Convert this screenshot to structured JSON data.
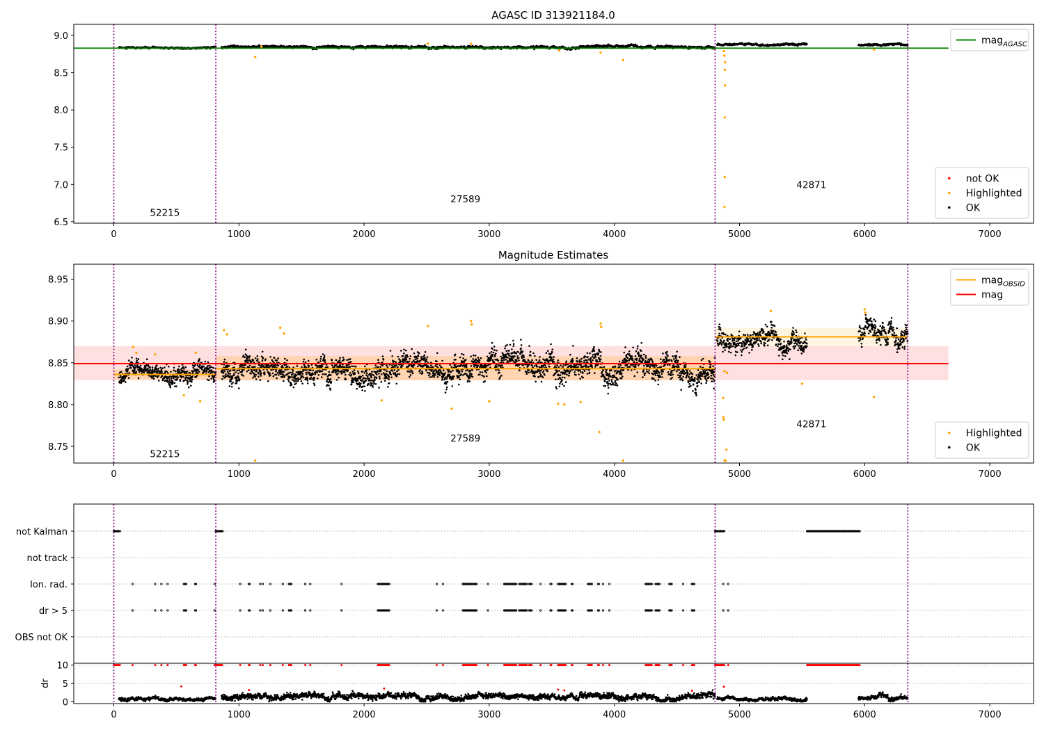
{
  "figure": {
    "background": "#ffffff"
  },
  "chart_data": [
    {
      "id": "top",
      "type": "scatter",
      "title": "AGASC ID 313921184.0",
      "xlim": [
        -320,
        7350
      ],
      "ylim": [
        6.48,
        9.15
      ],
      "xticks": [
        0,
        1000,
        2000,
        3000,
        4000,
        5000,
        6000,
        7000
      ],
      "xtick_labels": [
        "0",
        "1000",
        "2000",
        "3000",
        "4000",
        "5000",
        "6000",
        "7000"
      ],
      "yticks": [
        6.5,
        7.0,
        7.5,
        8.0,
        8.5,
        9.0
      ],
      "ytick_labels": [
        "6.5",
        "7.0",
        "7.5",
        "8.0",
        "8.5",
        "9.0"
      ],
      "obs_boundaries": [
        0,
        815,
        4805,
        6345
      ],
      "obs_labels": [
        {
          "text": "52215",
          "x": 408,
          "y": 6.58
        },
        {
          "text": "27589",
          "x": 2810,
          "y": 6.76
        },
        {
          "text": "42871",
          "x": 5575,
          "y": 6.95
        }
      ],
      "hlines": [
        {
          "name": "mag_AGASC",
          "y": 8.83,
          "x_from": -320,
          "x_to": 6670,
          "color": "#008000"
        }
      ],
      "ok_segments": [
        {
          "x0": 40,
          "x1": 815,
          "mean": 8.835,
          "sd": 0.008
        },
        {
          "x0": 860,
          "x1": 4805,
          "mean": 8.845,
          "sd": 0.012
        },
        {
          "x0": 4820,
          "x1": 5540,
          "mean": 8.878,
          "sd": 0.01
        },
        {
          "x0": 5950,
          "x1": 6345,
          "mean": 8.879,
          "sd": 0.01
        }
      ],
      "highlighted_points": [
        {
          "x": 1130,
          "y": 8.71
        },
        {
          "x": 2510,
          "y": 8.89
        },
        {
          "x": 2855,
          "y": 8.89
        },
        {
          "x": 3890,
          "y": 8.77
        },
        {
          "x": 4070,
          "y": 8.67
        },
        {
          "x": 4875,
          "y": 8.79
        },
        {
          "x": 4880,
          "y": 8.73
        },
        {
          "x": 4885,
          "y": 8.64
        },
        {
          "x": 4882,
          "y": 8.54
        },
        {
          "x": 4885,
          "y": 8.33
        },
        {
          "x": 4882,
          "y": 7.9
        },
        {
          "x": 4882,
          "y": 7.1
        },
        {
          "x": 4880,
          "y": 6.7
        },
        {
          "x": 6075,
          "y": 8.81
        },
        {
          "x": 1180,
          "y": 8.85
        },
        {
          "x": 3560,
          "y": 8.8
        }
      ],
      "not_ok_points": [],
      "legends": [
        {
          "position": "upper right",
          "entries": [
            {
              "kind": "line",
              "color": "#008000",
              "label": "mag",
              "sub": "AGASC"
            }
          ]
        },
        {
          "position": "lower right",
          "entries": [
            {
              "kind": "dot",
              "color": "#ff0000",
              "label": "not OK"
            },
            {
              "kind": "dot",
              "color": "#ffa500",
              "label": "Highlighted"
            },
            {
              "kind": "dot",
              "color": "#000000",
              "label": "OK"
            }
          ]
        }
      ]
    },
    {
      "id": "middle",
      "type": "scatter",
      "title": "Magnitude Estimates",
      "xlim": [
        -320,
        7350
      ],
      "ylim": [
        8.73,
        8.968
      ],
      "xticks": [
        0,
        1000,
        2000,
        3000,
        4000,
        5000,
        6000,
        7000
      ],
      "xtick_labels": [
        "0",
        "1000",
        "2000",
        "3000",
        "4000",
        "5000",
        "6000",
        "7000"
      ],
      "yticks": [
        8.75,
        8.8,
        8.85,
        8.9,
        8.95
      ],
      "ytick_labels": [
        "8.75",
        "8.80",
        "8.85",
        "8.90",
        "8.95"
      ],
      "obs_boundaries": [
        0,
        815,
        4805,
        6345
      ],
      "obs_labels": [
        {
          "text": "52215",
          "x": 408,
          "y": 8.737
        },
        {
          "text": "27589",
          "x": 2810,
          "y": 8.756
        },
        {
          "text": "42871",
          "x": 5575,
          "y": 8.773
        }
      ],
      "bands": [
        {
          "x0": -320,
          "x1": 6670,
          "y0": 8.829,
          "y1": 8.87,
          "color": "#ff0000",
          "opacity": 0.12
        },
        {
          "x0": 0,
          "x1": 815,
          "y0": 8.83,
          "y1": 8.842,
          "color": "#ffa500",
          "opacity": 0.2
        },
        {
          "x0": 815,
          "x1": 4805,
          "y0": 8.829,
          "y1": 8.858,
          "color": "#ffa500",
          "opacity": 0.2
        },
        {
          "x0": 4805,
          "x1": 6345,
          "y0": 8.87,
          "y1": 8.892,
          "color": "#ffa500",
          "opacity": 0.12
        }
      ],
      "hlines": [
        {
          "name": "mag",
          "y": 8.849,
          "x_from": -320,
          "x_to": 6670,
          "color": "#ff0000"
        },
        {
          "name": "mag_OBSID 52215",
          "y": 8.836,
          "x_from": 0,
          "x_to": 815,
          "color": "#ffa500"
        },
        {
          "name": "mag_OBSID 27589",
          "y": 8.843,
          "x_from": 815,
          "x_to": 4805,
          "color": "#ffa500"
        },
        {
          "name": "mag_OBSID 42871",
          "y": 8.881,
          "x_from": 4805,
          "x_to": 6345,
          "color": "#ffa500"
        }
      ],
      "ok_segments": [
        {
          "x0": 40,
          "x1": 815,
          "mean": 8.836,
          "sd": 0.008
        },
        {
          "x0": 860,
          "x1": 4805,
          "mean": 8.843,
          "sd": 0.011
        },
        {
          "x0": 4820,
          "x1": 5540,
          "mean": 8.879,
          "sd": 0.01
        },
        {
          "x0": 5950,
          "x1": 6345,
          "mean": 8.881,
          "sd": 0.01
        }
      ],
      "highlighted_points": [
        {
          "x": 155,
          "y": 8.869
        },
        {
          "x": 180,
          "y": 8.862
        },
        {
          "x": 330,
          "y": 8.86
        },
        {
          "x": 560,
          "y": 8.811
        },
        {
          "x": 690,
          "y": 8.804
        },
        {
          "x": 655,
          "y": 8.862
        },
        {
          "x": 880,
          "y": 8.889
        },
        {
          "x": 905,
          "y": 8.884
        },
        {
          "x": 1130,
          "y": 8.733
        },
        {
          "x": 1330,
          "y": 8.892
        },
        {
          "x": 1360,
          "y": 8.885
        },
        {
          "x": 2510,
          "y": 8.894
        },
        {
          "x": 2140,
          "y": 8.805
        },
        {
          "x": 2700,
          "y": 8.795
        },
        {
          "x": 2855,
          "y": 8.9
        },
        {
          "x": 2860,
          "y": 8.896
        },
        {
          "x": 3000,
          "y": 8.804
        },
        {
          "x": 3550,
          "y": 8.801
        },
        {
          "x": 3600,
          "y": 8.8
        },
        {
          "x": 3730,
          "y": 8.803
        },
        {
          "x": 3880,
          "y": 8.767
        },
        {
          "x": 3890,
          "y": 8.897
        },
        {
          "x": 3895,
          "y": 8.893
        },
        {
          "x": 4070,
          "y": 8.733
        },
        {
          "x": 4870,
          "y": 8.808
        },
        {
          "x": 4872,
          "y": 8.785
        },
        {
          "x": 4875,
          "y": 8.782
        },
        {
          "x": 4880,
          "y": 8.733
        },
        {
          "x": 4890,
          "y": 8.733
        },
        {
          "x": 4895,
          "y": 8.746
        },
        {
          "x": 4880,
          "y": 8.84
        },
        {
          "x": 4900,
          "y": 8.838
        },
        {
          "x": 5250,
          "y": 8.912
        },
        {
          "x": 5500,
          "y": 8.825
        },
        {
          "x": 6000,
          "y": 8.914
        },
        {
          "x": 6005,
          "y": 8.91
        },
        {
          "x": 6075,
          "y": 8.809
        }
      ],
      "legends": [
        {
          "position": "upper right",
          "entries": [
            {
              "kind": "line",
              "color": "#ffa500",
              "label": "mag",
              "sub": "OBSID"
            },
            {
              "kind": "line",
              "color": "#ff0000",
              "label": "mag",
              "sub": ""
            }
          ]
        },
        {
          "position": "lower right",
          "entries": [
            {
              "kind": "dot",
              "color": "#ffa500",
              "label": "Highlighted"
            },
            {
              "kind": "dot",
              "color": "#000000",
              "label": "OK"
            }
          ]
        }
      ]
    },
    {
      "id": "flags",
      "type": "scatter",
      "xlim": [
        -320,
        7350
      ],
      "categories": [
        "not Kalman",
        "not track",
        "Ion. rad.",
        "dr > 5",
        "OBS not OK"
      ],
      "obs_boundaries": [
        0,
        815,
        4805,
        6345
      ],
      "flag_ranges": {
        "not Kalman": [
          [
            0,
            50
          ],
          [
            815,
            870
          ],
          [
            4805,
            4880
          ],
          [
            5540,
            5960
          ]
        ],
        "not track": [],
        "Ion. rad.": [
          [
            150,
            150
          ],
          [
            330,
            330
          ],
          [
            380,
            380
          ],
          [
            430,
            430
          ],
          [
            560,
            580
          ],
          [
            650,
            660
          ],
          [
            805,
            810
          ],
          [
            1010,
            1010
          ],
          [
            1080,
            1090
          ],
          [
            1170,
            1170
          ],
          [
            1190,
            1190
          ],
          [
            1250,
            1250
          ],
          [
            1350,
            1350
          ],
          [
            1400,
            1420
          ],
          [
            1530,
            1530
          ],
          [
            1570,
            1570
          ],
          [
            1820,
            1820
          ],
          [
            2110,
            2200
          ],
          [
            2580,
            2580
          ],
          [
            2630,
            2630
          ],
          [
            2790,
            2900
          ],
          [
            2990,
            2990
          ],
          [
            3120,
            3220
          ],
          [
            3240,
            3300
          ],
          [
            3320,
            3340
          ],
          [
            3410,
            3410
          ],
          [
            3490,
            3500
          ],
          [
            3550,
            3610
          ],
          [
            3660,
            3670
          ],
          [
            3790,
            3820
          ],
          [
            3870,
            3880
          ],
          [
            3910,
            3910
          ],
          [
            3960,
            3960
          ],
          [
            4250,
            4300
          ],
          [
            4330,
            4360
          ],
          [
            4440,
            4460
          ],
          [
            4550,
            4550
          ],
          [
            4620,
            4640
          ],
          [
            4870,
            4870
          ],
          [
            4910,
            4910
          ]
        ],
        "dr > 5": [
          [
            150,
            150
          ],
          [
            330,
            330
          ],
          [
            380,
            380
          ],
          [
            430,
            430
          ],
          [
            560,
            580
          ],
          [
            650,
            660
          ],
          [
            805,
            810
          ],
          [
            1010,
            1010
          ],
          [
            1080,
            1090
          ],
          [
            1170,
            1170
          ],
          [
            1190,
            1190
          ],
          [
            1250,
            1250
          ],
          [
            1350,
            1350
          ],
          [
            1400,
            1420
          ],
          [
            1530,
            1530
          ],
          [
            1570,
            1570
          ],
          [
            1820,
            1820
          ],
          [
            2110,
            2200
          ],
          [
            2580,
            2580
          ],
          [
            2630,
            2630
          ],
          [
            2790,
            2900
          ],
          [
            2990,
            2990
          ],
          [
            3120,
            3220
          ],
          [
            3240,
            3300
          ],
          [
            3320,
            3340
          ],
          [
            3410,
            3410
          ],
          [
            3490,
            3500
          ],
          [
            3550,
            3610
          ],
          [
            3660,
            3670
          ],
          [
            3790,
            3820
          ],
          [
            3870,
            3880
          ],
          [
            3910,
            3910
          ],
          [
            3960,
            3960
          ],
          [
            4250,
            4300
          ],
          [
            4330,
            4360
          ],
          [
            4440,
            4460
          ],
          [
            4550,
            4550
          ],
          [
            4620,
            4640
          ],
          [
            4870,
            4870
          ],
          [
            4910,
            4910
          ]
        ],
        "OBS not OK": []
      }
    },
    {
      "id": "dr",
      "type": "scatter",
      "ylabel": "dr",
      "xlim": [
        -320,
        7350
      ],
      "ylim": [
        -0.5,
        10.5
      ],
      "xticks": [
        0,
        1000,
        2000,
        3000,
        4000,
        5000,
        6000,
        7000
      ],
      "xtick_labels": [
        "0",
        "1000",
        "2000",
        "3000",
        "4000",
        "5000",
        "6000",
        "7000"
      ],
      "yticks": [
        0,
        5,
        10
      ],
      "ytick_labels": [
        "0",
        "5",
        "10"
      ],
      "obs_boundaries": [
        0,
        815,
        4805,
        6345
      ],
      "ok_segments": [
        {
          "x0": 40,
          "x1": 815,
          "mean": 0.8,
          "sd": 0.35
        },
        {
          "x0": 860,
          "x1": 4805,
          "mean": 1.3,
          "sd": 0.6
        },
        {
          "x0": 4820,
          "x1": 5540,
          "mean": 0.8,
          "sd": 0.35
        },
        {
          "x0": 5950,
          "x1": 6345,
          "mean": 1.0,
          "sd": 0.45
        }
      ],
      "clipped_red_ranges": [
        [
          0,
          50
        ],
        [
          150,
          150
        ],
        [
          330,
          330
        ],
        [
          380,
          380
        ],
        [
          430,
          430
        ],
        [
          560,
          580
        ],
        [
          650,
          660
        ],
        [
          805,
          870
        ],
        [
          1010,
          1010
        ],
        [
          1080,
          1090
        ],
        [
          1170,
          1170
        ],
        [
          1190,
          1190
        ],
        [
          1250,
          1250
        ],
        [
          1350,
          1350
        ],
        [
          1400,
          1420
        ],
        [
          1530,
          1530
        ],
        [
          1570,
          1570
        ],
        [
          1820,
          1820
        ],
        [
          2110,
          2200
        ],
        [
          2580,
          2580
        ],
        [
          2630,
          2630
        ],
        [
          2790,
          2900
        ],
        [
          2990,
          2990
        ],
        [
          3120,
          3220
        ],
        [
          3240,
          3300
        ],
        [
          3320,
          3340
        ],
        [
          3410,
          3410
        ],
        [
          3490,
          3500
        ],
        [
          3550,
          3610
        ],
        [
          3660,
          3670
        ],
        [
          3790,
          3820
        ],
        [
          3870,
          3880
        ],
        [
          3910,
          3910
        ],
        [
          3960,
          3960
        ],
        [
          4250,
          4300
        ],
        [
          4330,
          4360
        ],
        [
          4440,
          4460
        ],
        [
          4550,
          4550
        ],
        [
          4620,
          4640
        ],
        [
          4805,
          4880
        ],
        [
          4910,
          4910
        ],
        [
          5540,
          5960
        ]
      ],
      "red_points": [
        {
          "x": 540,
          "y": 4.2
        },
        {
          "x": 1080,
          "y": 3.2
        },
        {
          "x": 2160,
          "y": 3.6
        },
        {
          "x": 3550,
          "y": 3.3
        },
        {
          "x": 3600,
          "y": 3.1
        },
        {
          "x": 4620,
          "y": 3.0
        },
        {
          "x": 4875,
          "y": 4.1
        }
      ]
    }
  ]
}
